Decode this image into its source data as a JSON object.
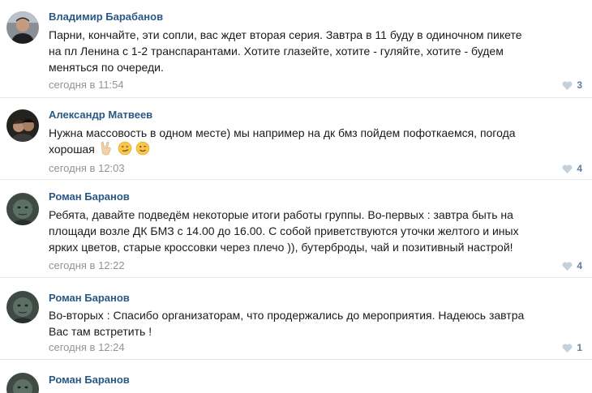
{
  "comments": [
    {
      "author": "Владимир Барабанов",
      "lines": [
        "Парни, кончайте, эти сопли, вас ждет вторая серия. Завтра в 11 буду в одиночном пикете",
        "на пл Ленина с 1-2 транспарантами. Хотите глазейте, хотите - гуляйте, хотите - будем",
        "меняться по очереди."
      ],
      "time": "сегодня в 11:54",
      "likes": "3",
      "emojis": []
    },
    {
      "author": "Александр Матвеев",
      "lines": [
        "Нужна массовость в одном месте) мы например на дк бмз пойдем пофоткаемся, погода",
        "хорошая"
      ],
      "time": "сегодня в 12:03",
      "likes": "4",
      "emojis": [
        "victory-hand",
        "smirk-face",
        "wink-face"
      ]
    },
    {
      "author": "Роман Баранов",
      "lines": [
        "Ребята, давайте подведём некоторые итоги работы группы. Во-первых : завтра быть на",
        "площади возле ДК БМЗ с 14.00 до 16.00. С собой приветствуются уточки желтого и иных",
        "ярких цветов, старые кроссовки через плечо )), бутерброды, чай и позитивный настрой!"
      ],
      "time": "сегодня в 12:22",
      "likes": "4",
      "emojis": []
    },
    {
      "author": "Роман Баранов",
      "lines": [
        "Во-вторых : Спасибо организаторам, что продержались до мероприятия. Надеюсь завтра",
        "Вас там встретить !"
      ],
      "time": "сегодня в 12:24",
      "likes": "1",
      "emojis": []
    },
    {
      "author": "Роман Баранов",
      "lines": [],
      "time": "",
      "likes": "",
      "emojis": []
    }
  ],
  "colors": {
    "author": "#2a5885",
    "meta": "#939393",
    "likes": "#5f7fa3",
    "divider": "#e7e8ec"
  }
}
